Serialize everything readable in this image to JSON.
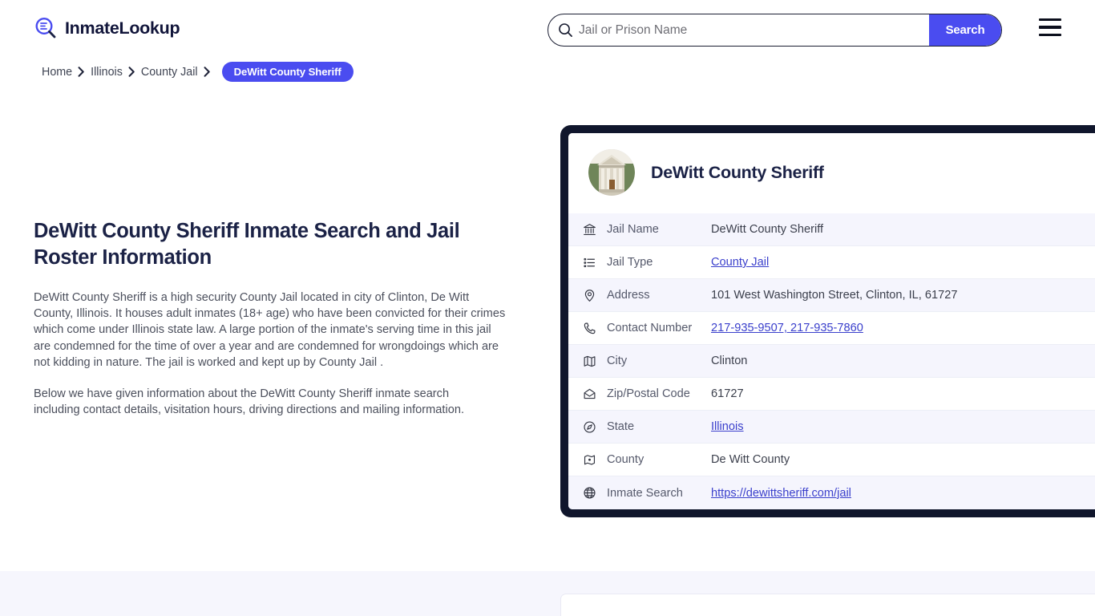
{
  "brand": {
    "name": "InmateLookup",
    "icon": "search-list-logo-icon",
    "accent": "#4a4cf0"
  },
  "search": {
    "placeholder": "Jail or Prison Name",
    "value": "",
    "button_label": "Search",
    "icon": "search-icon"
  },
  "menu": {
    "icon": "hamburger-menu-icon"
  },
  "breadcrumb": {
    "items": [
      {
        "label": "Home",
        "current": false
      },
      {
        "label": "Illinois",
        "current": false
      },
      {
        "label": "County Jail",
        "current": false
      }
    ],
    "current": "DeWitt County Sheriff",
    "separator_icon": "chevron-right-icon"
  },
  "main": {
    "title": "DeWitt County Sheriff Inmate Search and Jail Roster Information",
    "paragraph_1": "DeWitt County Sheriff is a high security County Jail located in city of Clinton, De Witt County, Illinois. It houses adult inmates (18+ age) who have been convicted for their crimes which come under Illinois state law. A large portion of the inmate's serving time in this jail are condemned for the time of over a year and are condemned for wrongdoings which are not kidding in nature. The jail is worked and kept up by County Jail .",
    "paragraph_2": "Below we have given information about the DeWitt County Sheriff inmate search including contact details, visitation hours, driving directions and mailing information."
  },
  "card": {
    "avatar_icon": "courthouse-photo",
    "title": "DeWitt County Sheriff",
    "rows": [
      {
        "icon": "bank-icon",
        "label": "Jail Name",
        "value": "DeWitt County Sheriff",
        "link": false
      },
      {
        "icon": "list-icon",
        "label": "Jail Type",
        "value": "County Jail",
        "link": true
      },
      {
        "icon": "map-pin-icon",
        "label": "Address",
        "value": "101 West Washington Street, Clinton, IL, 61727",
        "link": false
      },
      {
        "icon": "phone-icon",
        "label": "Contact Number",
        "value": "217-935-9507, 217-935-7860",
        "link": true
      },
      {
        "icon": "map-icon",
        "label": "City",
        "value": "Clinton",
        "link": false
      },
      {
        "icon": "envelope-icon",
        "label": "Zip/Postal Code",
        "value": "61727",
        "link": false
      },
      {
        "icon": "globe-compass-icon",
        "label": "State",
        "value": "Illinois",
        "link": true
      },
      {
        "icon": "map-marker-icon",
        "label": "County",
        "value": "De Witt County",
        "link": false
      },
      {
        "icon": "globe-icon",
        "label": "Inmate Search",
        "value": "https://dewittsheriff.com/jail",
        "link": true
      }
    ]
  }
}
